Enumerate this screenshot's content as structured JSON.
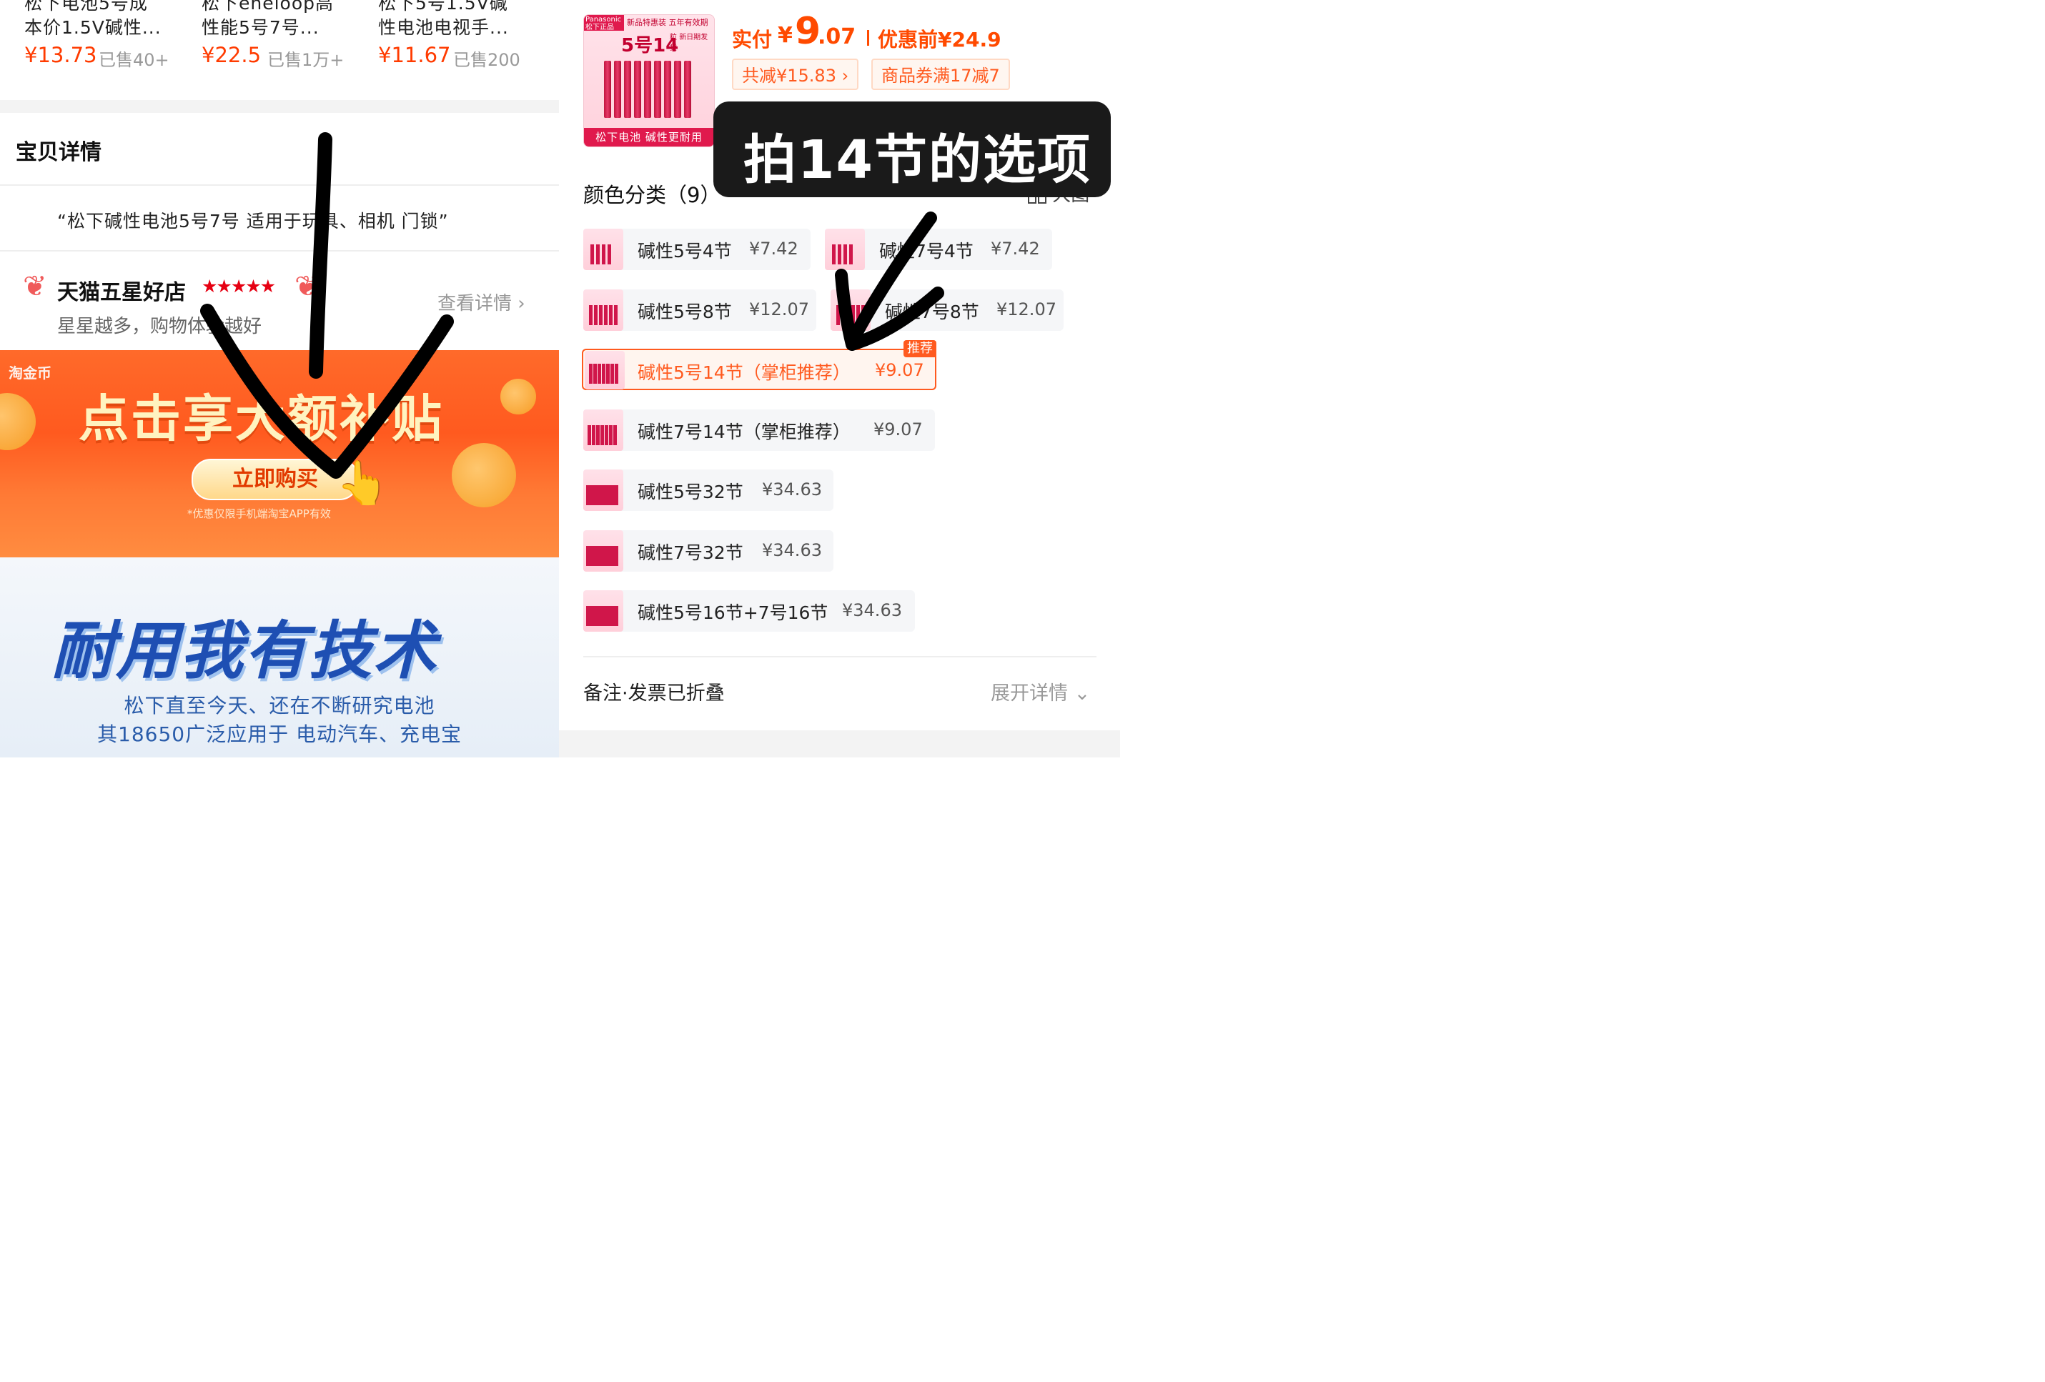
{
  "left": {
    "recommendations": [
      {
        "title_line1": "松下电池5号成",
        "title_line2": "本价1.5V碱性...",
        "price": "¥13.73",
        "sold": "已售40+"
      },
      {
        "title_line1": "松下eneloop高",
        "title_line2": "性能5号7号...",
        "price": "¥22.5",
        "sold": "已售1万+"
      },
      {
        "title_line1": "松下5号1.5V碱",
        "title_line2": "性电池电视手...",
        "price": "¥11.67",
        "sold": "已售200"
      }
    ],
    "detail_heading": "宝贝详情",
    "product_quote": "“松下碱性电池5号7号 适用于玩具、相机 门锁”",
    "store": {
      "title": "天猫五星好店",
      "stars": "★★★★★",
      "subtitle": "星星越多，购物体验越好",
      "link": "查看详情"
    },
    "banner": {
      "logo": "淘金币",
      "title": "点击享大额补贴",
      "button": "立即购买",
      "note": "*优惠仅限手机端淘宝APP有效"
    },
    "tech": {
      "title": "耐用我有技术",
      "line1": "松下直至今天、还在不断研究电池",
      "line2": "其18650广泛应用于 电动汽车、充电宝"
    }
  },
  "right": {
    "thumbnail": {
      "brand": "Panasonic 松下正品",
      "topline": "新品特惠装 五年有效期",
      "count": "5号14",
      "unit": "粒",
      "sub": "新日期发货",
      "footer": "松下电池 碱性更耐用"
    },
    "pay": {
      "label": "实付",
      "yen": "¥",
      "int": "9",
      "dec": ".07",
      "pre": "优惠前¥24.9"
    },
    "chips": [
      "共减¥15.83 ›",
      "商品券满17减7"
    ],
    "callout": "拍14节的选项",
    "color_heading": "颜色分类（9）",
    "big_view": "大图",
    "options": [
      {
        "label": "碱性5号4节",
        "price": "¥7.42",
        "selected": false
      },
      {
        "label": "碱性7号4节",
        "price": "¥7.42",
        "selected": false
      },
      {
        "label": "碱性5号8节",
        "price": "¥12.07",
        "selected": false
      },
      {
        "label": "碱性7号8节",
        "price": "¥12.07",
        "selected": false
      },
      {
        "label": "碱性5号14节（掌柜推荐）",
        "price": "¥9.07",
        "selected": true,
        "tag": "推荐"
      },
      {
        "label": "碱性7号14节（掌柜推荐）",
        "price": "¥9.07",
        "selected": false
      },
      {
        "label": "碱性5号32节",
        "price": "¥34.63",
        "selected": false
      },
      {
        "label": "碱性7号32节",
        "price": "¥34.63",
        "selected": false
      },
      {
        "label": "碱性5号16节+7号16节",
        "price": "¥34.63",
        "selected": false
      }
    ],
    "remark": "备注·发票已折叠",
    "expand": "展开详情 ⌄"
  }
}
